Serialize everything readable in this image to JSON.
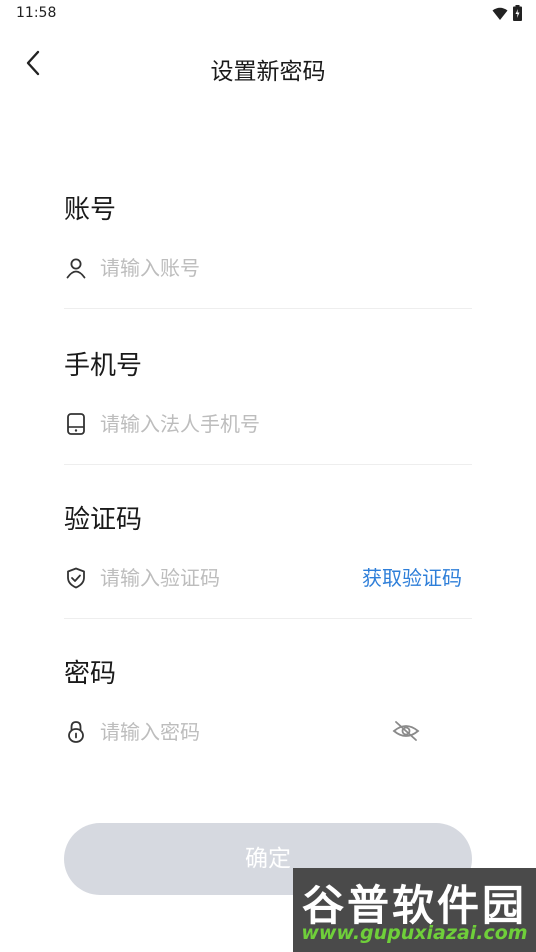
{
  "status_bar": {
    "time": "11:58",
    "icons": [
      "wifi-icon",
      "battery-icon"
    ]
  },
  "header": {
    "title": "设置新密码",
    "back_icon": "chevron-left-icon"
  },
  "form": {
    "account": {
      "label": "账号",
      "placeholder": "请输入账号",
      "icon": "user-icon"
    },
    "phone": {
      "label": "手机号",
      "placeholder": "请输入法人手机号",
      "icon": "phone-icon"
    },
    "code": {
      "label": "验证码",
      "placeholder": "请输入验证码",
      "icon": "shield-check-icon",
      "get_code_label": "获取验证码"
    },
    "password": {
      "label": "密码",
      "placeholder": "请输入密码",
      "icon": "lock-icon",
      "toggle_icon": "eye-off-icon"
    }
  },
  "confirm_label": "确定",
  "watermark": {
    "brand": "谷普软件园",
    "url": "www.gupuxiazai.com"
  },
  "colors": {
    "link": "#2f7fd9",
    "button_disabled": "#d6d9e0",
    "placeholder": "#bdbdbd"
  }
}
